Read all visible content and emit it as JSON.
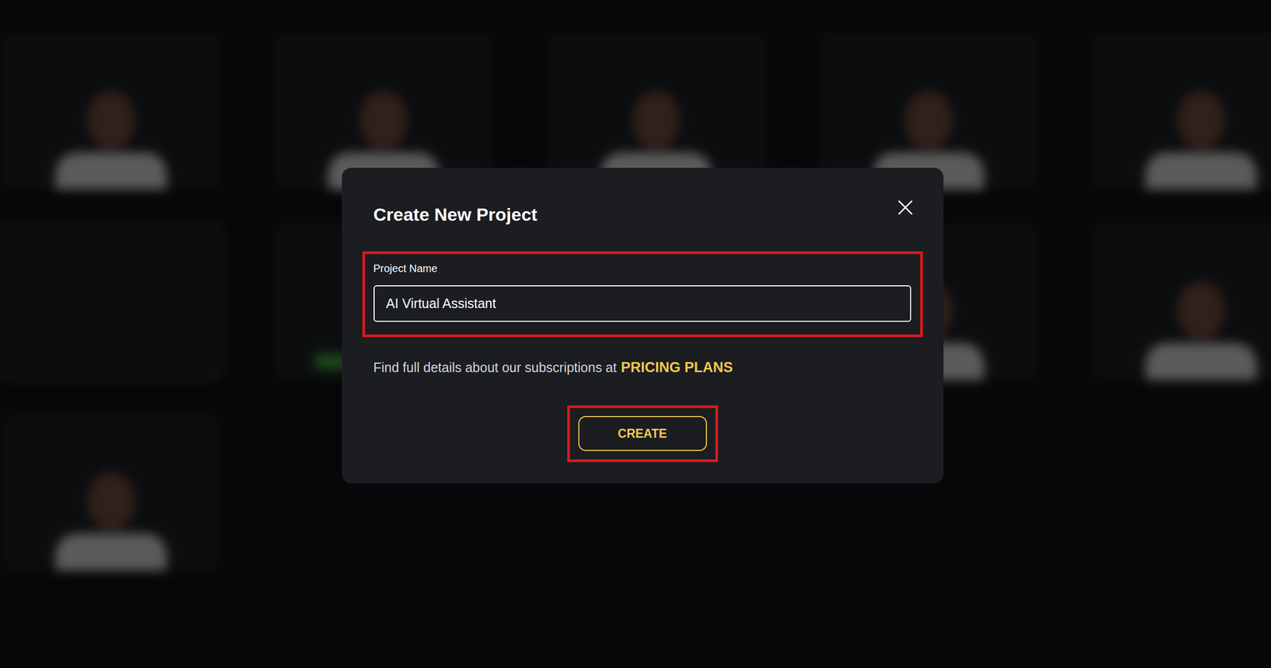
{
  "dialog": {
    "title": "Create New Project"
  },
  "field": {
    "label": "Project Name",
    "value": "AI Virtual Assistant",
    "highlighted": true
  },
  "note": {
    "text": "Find full details about our subscriptions at",
    "link": "PRICING PLANS"
  },
  "buttons": [
    {
      "label": "CREATE",
      "highlighted": true
    }
  ],
  "background_cards": [
    {
      "kind": "avatar"
    },
    {
      "kind": "avatar"
    },
    {
      "kind": "avatar"
    },
    {
      "kind": "avatar"
    },
    {
      "kind": "avatar"
    },
    {
      "kind": "new"
    },
    {
      "kind": "avatar",
      "color": "#3f9a3c"
    },
    {
      "kind": "avatar"
    },
    {
      "kind": "avatar"
    },
    {
      "kind": "avatar"
    },
    {
      "kind": "avatar"
    }
  ]
}
